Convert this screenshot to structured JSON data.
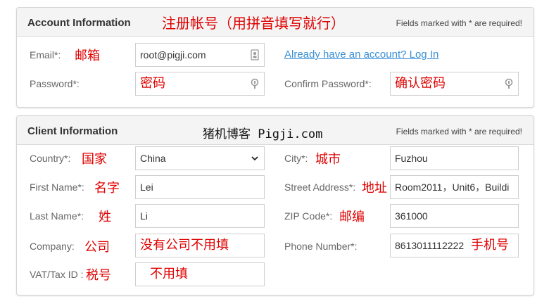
{
  "account": {
    "title": "Account Information",
    "required_note": "Fields marked with * are required!",
    "annotation": "注册帐号（用拼音填写就行）",
    "email": {
      "label": "Email*:",
      "annotation": "邮箱",
      "value": "root@pigji.com"
    },
    "login_link": "Already have an account? Log In",
    "password": {
      "label": "Password*:",
      "value_annotation": "密码"
    },
    "confirm_password": {
      "label": "Confirm Password*:",
      "value_annotation": "确认密码"
    }
  },
  "client": {
    "title": "Client Information",
    "required_note": "Fields marked with * are required!",
    "watermark": "猪机博客 Pigji.com",
    "country": {
      "label": "Country*:",
      "annotation": "国家",
      "value": "China"
    },
    "city": {
      "label": "City*:",
      "annotation": "城市",
      "value": "Fuzhou"
    },
    "first_name": {
      "label": "First Name*:",
      "annotation": "名字",
      "value": "Lei"
    },
    "street": {
      "label": "Street Address*:",
      "annotation": "地址",
      "value": "Room2011，Unit6，Buildi"
    },
    "last_name": {
      "label": "Last Name*:",
      "annotation": "姓",
      "value": "Li"
    },
    "zip": {
      "label": "ZIP Code*:",
      "annotation": "邮编",
      "value": "361000"
    },
    "company": {
      "label": "Company:",
      "annotation": "公司",
      "value_annotation": "没有公司不用填"
    },
    "phone": {
      "label": "Phone Number*:",
      "value": "8613011112222",
      "annotation": "手机号"
    },
    "vat": {
      "label": "VAT/Tax ID :",
      "annotation": "税号",
      "value_annotation": "不用填"
    }
  },
  "colors": {
    "annotation": "#e00000",
    "link": "#3a8fd6",
    "header_bg": "#f4f4f4"
  },
  "icons": {
    "password_field": "key-icon",
    "email_field": "card-icon",
    "select": "chevron-down-icon"
  }
}
